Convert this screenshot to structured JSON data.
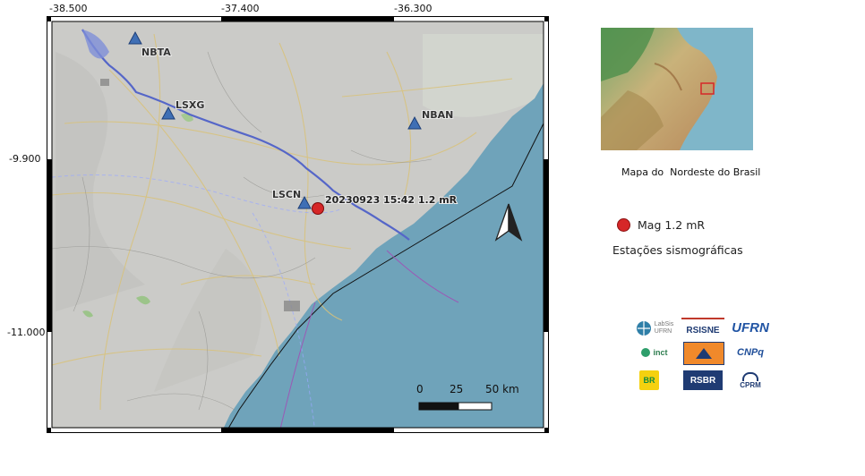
{
  "map": {
    "lon_ticks": [
      "-38.500",
      "-37.400",
      "-36.300"
    ],
    "lat_ticks": [
      "-9.900",
      "-11.000"
    ],
    "stations": [
      {
        "code": "NBTA"
      },
      {
        "code": "LSXG"
      },
      {
        "code": "NBAN"
      },
      {
        "code": "LSCN"
      }
    ],
    "event_label": "20230923 15:42 1.2 mR",
    "scale_labels": [
      "0",
      "25",
      "50 km"
    ],
    "colors": {
      "sea": "#6fa3ba",
      "land": "#c9c9c6",
      "event": "#d62728",
      "station": "#3f6fb5",
      "river": "#5566c8"
    }
  },
  "inset": {
    "caption": "Mapa do  Nordeste do Brasil"
  },
  "legend": {
    "event_label": "Mag 1.2 mR",
    "stations_label": "Estações sismográficas"
  },
  "logos": {
    "labsis_line1": "LabSis",
    "labsis_line2": "UFRN",
    "rsisne": "RSISNE",
    "ufrn": "UFRN",
    "inct": "inct",
    "cnpq": "CNPq",
    "br_text": "BR",
    "rsbr": "RSBR",
    "cprm": "CPRM"
  }
}
